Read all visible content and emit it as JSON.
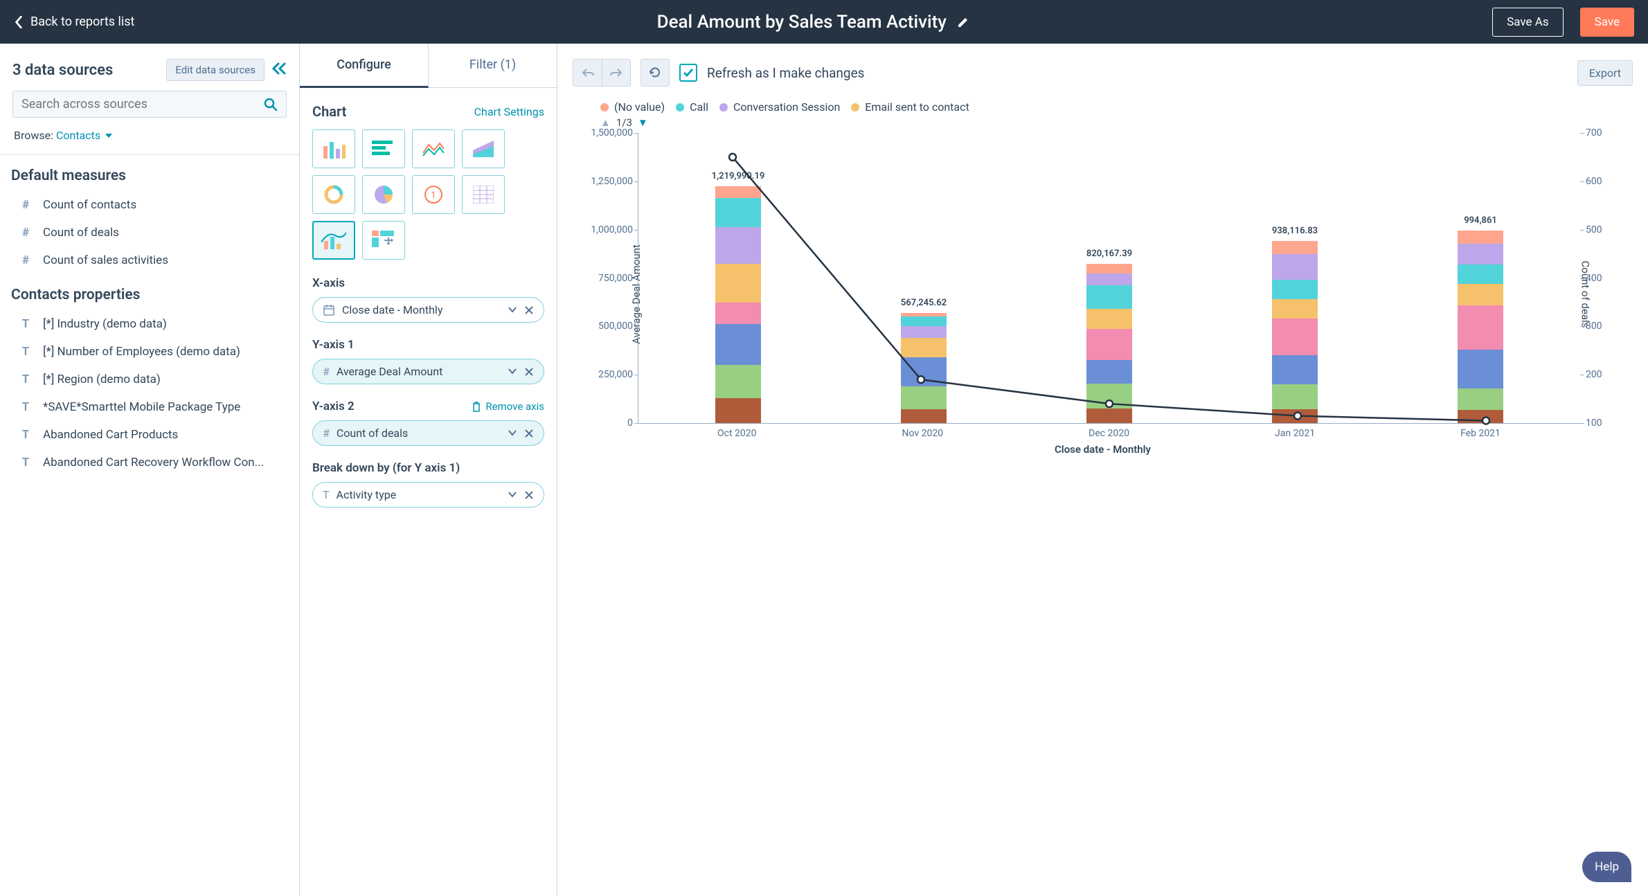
{
  "topbar": {
    "back_label": "Back to reports list",
    "title": "Deal Amount by Sales Team Activity",
    "save_as": "Save As",
    "save": "Save"
  },
  "left": {
    "heading": "3 data sources",
    "edit_btn": "Edit data sources",
    "search_placeholder": "Search across sources",
    "browse_label": "Browse:",
    "browse_value": "Contacts",
    "sec_measures": "Default measures",
    "measures": [
      {
        "icon": "#",
        "label": "Count of contacts"
      },
      {
        "icon": "#",
        "label": "Count of deals"
      },
      {
        "icon": "#",
        "label": "Count of sales activities"
      }
    ],
    "sec_props": "Contacts properties",
    "props": [
      {
        "icon": "T",
        "label": "[*] Industry (demo data)"
      },
      {
        "icon": "T",
        "label": "[*] Number of Employees (demo data)"
      },
      {
        "icon": "T",
        "label": "[*] Region (demo data)"
      },
      {
        "icon": "T",
        "label": "*SAVE*Smarttel Mobile Package Type"
      },
      {
        "icon": "T",
        "label": "Abandoned Cart Products"
      },
      {
        "icon": "T",
        "label": "Abandoned Cart Recovery Workflow Con..."
      }
    ]
  },
  "mid": {
    "tab_configure": "Configure",
    "tab_filter": "Filter (1)",
    "chart_heading": "Chart",
    "chart_settings": "Chart Settings",
    "xaxis_label": "X-axis",
    "xaxis_value": "Close date - Monthly",
    "y1_label": "Y-axis 1",
    "y1_value": "Average Deal Amount",
    "y2_label": "Y-axis 2",
    "y2_remove": "Remove axis",
    "y2_value": "Count of deals",
    "breakdown_label": "Break down by (for Y axis 1)",
    "breakdown_value": "Activity type"
  },
  "right": {
    "refresh_label": "Refresh as I make changes",
    "export": "Export",
    "pager": "1/3"
  },
  "help": "Help",
  "chart_data": {
    "type": "bar",
    "categories": [
      "Oct 2020",
      "Nov 2020",
      "Dec 2020",
      "Jan 2021",
      "Feb 2021"
    ],
    "bar_totals": [
      1219990.19,
      567245.62,
      820167.39,
      938116.83,
      994861
    ],
    "bar_labels": [
      "1,219,990.19",
      "567,245.62",
      "820,167.39",
      "938,116.83",
      "994,861"
    ],
    "series_colors": {
      "no_value": "#f5c26b",
      "call": "#51d3d9",
      "conversation": "#bda7ea",
      "email": "#fea58e",
      "other1": "#6a8fd6",
      "other2": "#f28cb1",
      "other3": "#99cf83",
      "other4": "#b05c3b"
    },
    "stacks": [
      [
        [
          "other4",
          130000
        ],
        [
          "other3",
          170000
        ],
        [
          "other1",
          210000
        ],
        [
          "other2",
          110000
        ],
        [
          "no_value",
          200000
        ],
        [
          "conversation",
          190000
        ],
        [
          "call",
          150000
        ],
        [
          "email",
          60000
        ]
      ],
      [
        [
          "other4",
          70000
        ],
        [
          "other3",
          120000
        ],
        [
          "other1",
          150000
        ],
        [
          "no_value",
          100000
        ],
        [
          "conversation",
          60000
        ],
        [
          "call",
          50000
        ],
        [
          "email",
          17000
        ]
      ],
      [
        [
          "other4",
          75000
        ],
        [
          "other3",
          130000
        ],
        [
          "other1",
          120000
        ],
        [
          "other2",
          160000
        ],
        [
          "no_value",
          105000
        ],
        [
          "call",
          120000
        ],
        [
          "conversation",
          60000
        ],
        [
          "email",
          50000
        ]
      ],
      [
        [
          "other4",
          70000
        ],
        [
          "other3",
          130000
        ],
        [
          "other1",
          150000
        ],
        [
          "other2",
          190000
        ],
        [
          "no_value",
          100000
        ],
        [
          "call",
          100000
        ],
        [
          "conversation",
          130000
        ],
        [
          "email",
          68000
        ]
      ],
      [
        [
          "other4",
          68000
        ],
        [
          "other3",
          110000
        ],
        [
          "other1",
          200000
        ],
        [
          "other2",
          230000
        ],
        [
          "no_value",
          110000
        ],
        [
          "call",
          100000
        ],
        [
          "conversation",
          106000
        ],
        [
          "email",
          70000
        ]
      ]
    ],
    "line_series": {
      "name": "Count of deals",
      "values": [
        650,
        190,
        140,
        115,
        105
      ]
    },
    "ylabel_left": "Average Deal Amount",
    "ylabel_right": "Count of deals",
    "xlabel": "Close date - Monthly",
    "ylim_left": [
      0,
      1500000
    ],
    "ylim_right": [
      100,
      700
    ],
    "yticks_left": [
      "0",
      "250,000",
      "500,000",
      "750,000",
      "1,000,000",
      "1,250,000",
      "1,500,000"
    ],
    "yticks_right": [
      "100",
      "200",
      "300",
      "400",
      "500",
      "600",
      "700"
    ],
    "legend": [
      {
        "label": "(No value)",
        "color": "#fea58e"
      },
      {
        "label": "Call",
        "color": "#51d3d9"
      },
      {
        "label": "Conversation Session",
        "color": "#bda7ea"
      },
      {
        "label": "Email sent to contact",
        "color": "#f5c26b"
      }
    ]
  }
}
